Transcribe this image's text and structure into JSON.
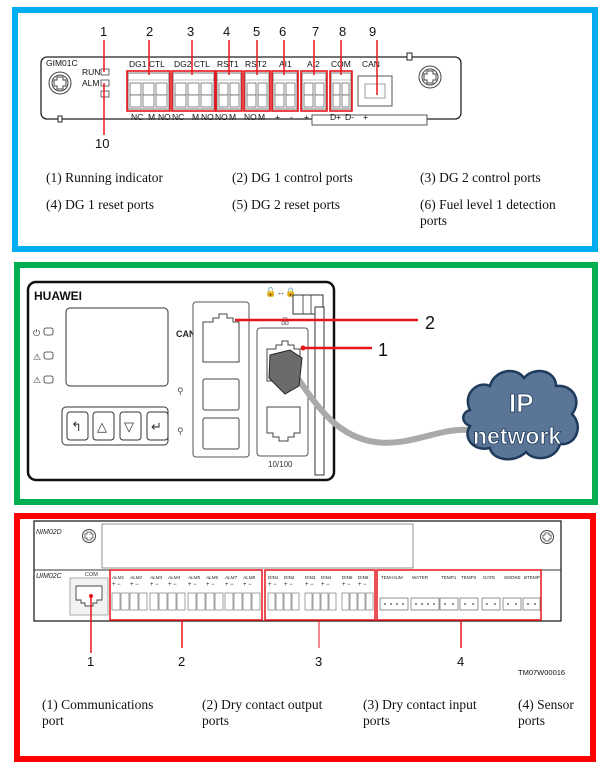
{
  "colors": {
    "panel1_border": "#00AEEF",
    "panel2_border": "#00B050",
    "panel3_border": "#FF0000",
    "callout_red": "#E8151B",
    "cloud_fill": "#5A7596",
    "cloud_stroke": "#1F3B5C"
  },
  "panel1": {
    "module_name": "GIM01C",
    "leds": [
      "RUN",
      "ALM"
    ],
    "port_groups": [
      {
        "label": "DG1 CTL",
        "pins": [
          "NC",
          "M",
          "NO"
        ]
      },
      {
        "label": "DG2 CTL",
        "pins": [
          "NC",
          "M",
          "NO"
        ]
      },
      {
        "label": "RST1",
        "pins": [
          "NO",
          "M"
        ]
      },
      {
        "label": "RST2",
        "pins": [
          "NO",
          "M"
        ]
      },
      {
        "label": "AI1",
        "pins": [
          "+",
          "-"
        ]
      },
      {
        "label": "AI2",
        "pins": [
          "+",
          ""
        ]
      },
      {
        "label": "COM",
        "pins": [
          "D+",
          "D-"
        ]
      },
      {
        "label": "CAN",
        "pins": [
          "+"
        ]
      }
    ],
    "callouts": [
      "1",
      "2",
      "3",
      "4",
      "5",
      "6",
      "7",
      "8",
      "9",
      "10"
    ],
    "captions": [
      "(1) Running indicator",
      "(2) DG 1 control ports",
      "(3) DG 2 control ports",
      "(4) DG 1 reset ports",
      "(5) DG 2 reset ports",
      "(6) Fuel level 1 detection ports"
    ]
  },
  "panel2": {
    "brand": "HUAWEI",
    "can_label": "CAN",
    "fe_label": "10/100",
    "buttons": [
      "back",
      "up",
      "down",
      "enter"
    ],
    "callouts": [
      "2",
      "1"
    ],
    "cloud_line1": "IP",
    "cloud_line2": "network"
  },
  "panel3": {
    "top_module": "NIM02D",
    "bottom_module": "UIM02C",
    "com_label": "COM",
    "alarm_outputs": [
      "ALM1",
      "ALM2",
      "ALM3",
      "ALM4",
      "ALM5",
      "ALM6",
      "ALM7",
      "ALM8"
    ],
    "dry_inputs": [
      "DIN1",
      "DIN2",
      "DIN3",
      "DIN4",
      "DIN5",
      "DIN6"
    ],
    "sensor_ports": [
      "TEM-HUM",
      "WATER",
      "TEMP1",
      "TEMP2",
      "GATE",
      "SMOKE",
      "BTEMP"
    ],
    "polarity": "+ −",
    "callouts": [
      "1",
      "2",
      "3",
      "4"
    ],
    "figure_id": "TM07W00016",
    "captions": [
      "(1) Communications port",
      "(2) Dry contact output ports",
      "(3) Dry contact input ports",
      "(4) Sensor ports"
    ]
  }
}
